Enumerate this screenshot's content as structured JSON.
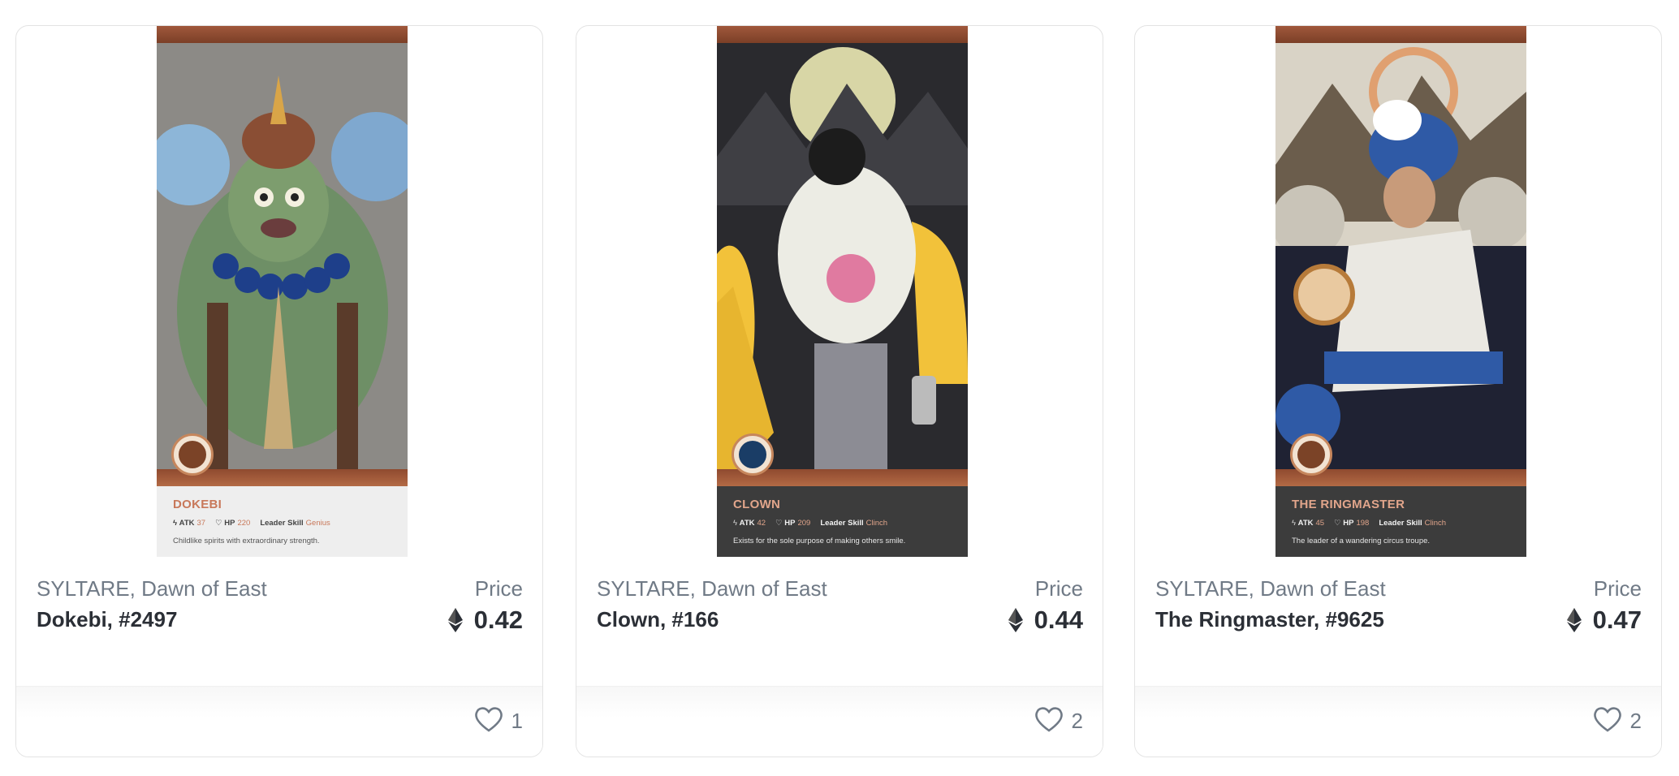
{
  "cards": [
    {
      "character": "DOKEBI",
      "atk_label": "ATK",
      "atk": "37",
      "hp_label": "HP",
      "hp": "220",
      "skill_label": "Leader Skill",
      "skill": "Genius",
      "description": "Childlike spirits with extraordinary strength.",
      "collection": "SYLTARE, Dawn of East",
      "name": "Dokebi, #2497",
      "price_label": "Price",
      "price": "0.42",
      "likes": "1",
      "theme": "light",
      "art_icon": "dokebi-artwork"
    },
    {
      "character": "CLOWN",
      "atk_label": "ATK",
      "atk": "42",
      "hp_label": "HP",
      "hp": "209",
      "skill_label": "Leader Skill",
      "skill": "Clinch",
      "description": "Exists for the sole purpose of making others smile.",
      "collection": "SYLTARE, Dawn of East",
      "name": "Clown, #166",
      "price_label": "Price",
      "price": "0.44",
      "likes": "2",
      "theme": "dark",
      "art_icon": "clown-artwork"
    },
    {
      "character": "THE RINGMASTER",
      "atk_label": "ATK",
      "atk": "45",
      "hp_label": "HP",
      "hp": "198",
      "skill_label": "Leader Skill",
      "skill": "Clinch",
      "description": "The leader of a wandering circus troupe.",
      "collection": "SYLTARE, Dawn of East",
      "name": "The Ringmaster, #9625",
      "price_label": "Price",
      "price": "0.47",
      "likes": "2",
      "theme": "dark",
      "art_icon": "ringmaster-artwork"
    }
  ],
  "colors": {
    "accent": "#c8785a",
    "text_primary": "#2b2f36",
    "text_secondary": "#707a86",
    "card_border": "#e3e3e3"
  }
}
